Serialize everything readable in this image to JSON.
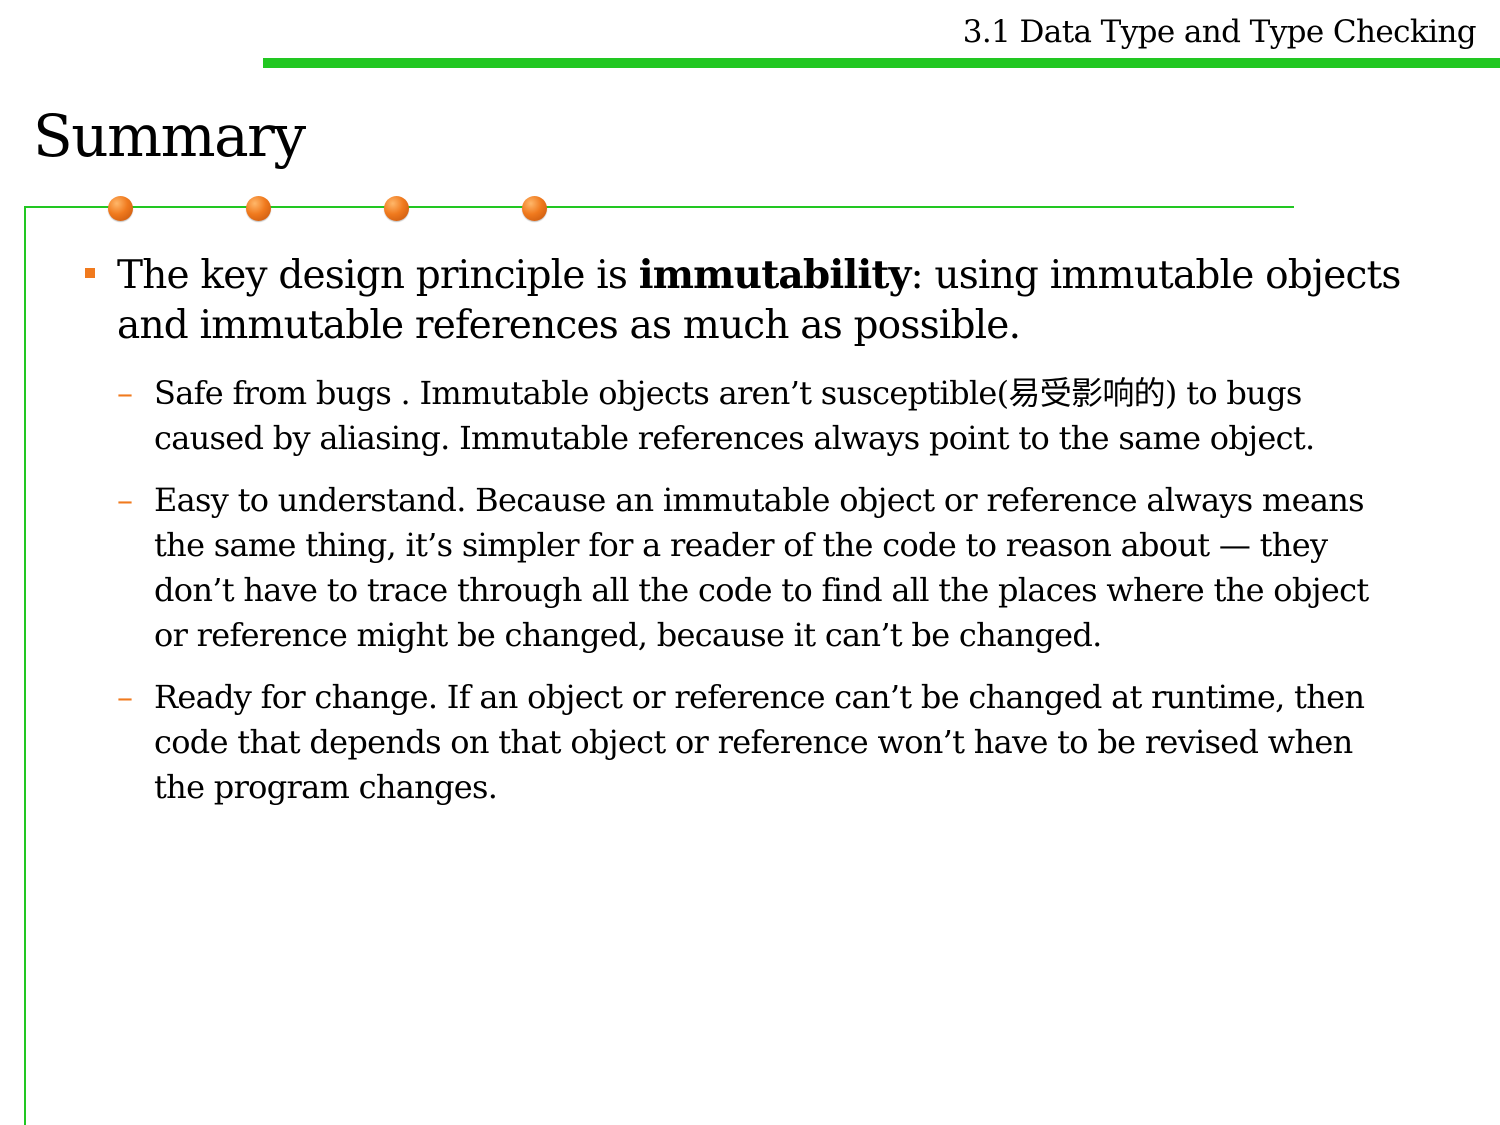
{
  "header": {
    "section_title": "3.1 Data Type and Type Checking",
    "accent_color": "#22c722"
  },
  "slide": {
    "title": "Summary"
  },
  "main_bullet": {
    "text_before": "The key design principle is ",
    "bold_term": "immutability",
    "text_after": ": using immutable objects and immutable references as much as possible."
  },
  "sub_bullets": [
    {
      "text": "Safe from bugs . Immutable objects aren’t susceptible(易受影响的) to bugs caused by aliasing. Immutable references always point to the same object."
    },
    {
      "text": "Easy to understand. Because an immutable object or reference always means the same thing, it’s simpler for a reader of the code to reason about — they don’t have to trace through all the code to find all the places where the object or reference might be changed, because it can’t be changed."
    },
    {
      "text": "Ready for change. If an object or reference can’t be changed at runtime, then code that depends on that object or reference won’t have to be revised when the program changes."
    }
  ],
  "markers": {
    "bullet_color": "#f07a1e",
    "sub_marker": "–"
  }
}
